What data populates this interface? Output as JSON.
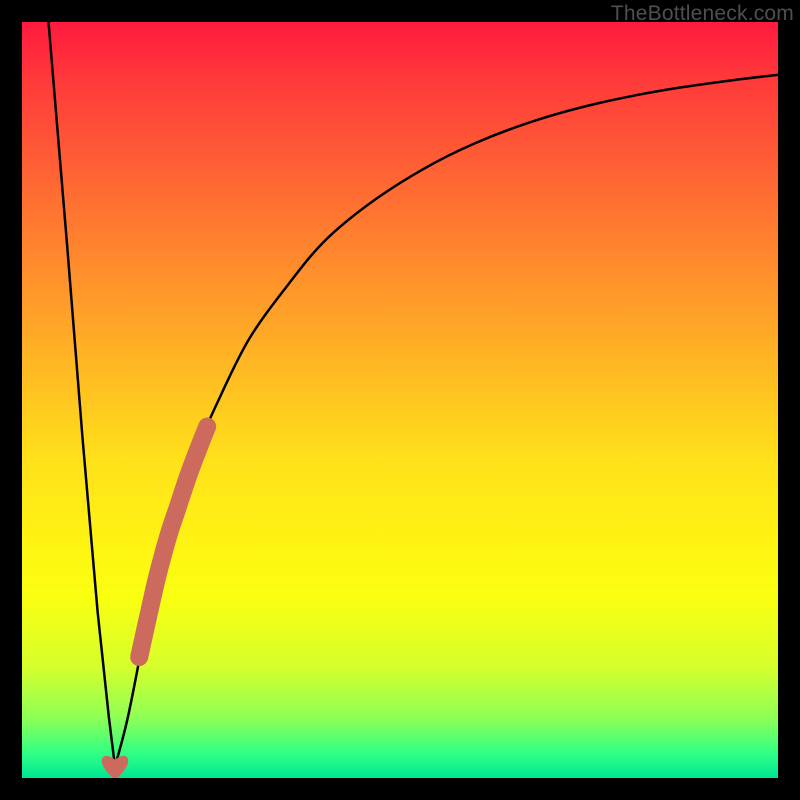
{
  "watermark": "TheBottleneck.com",
  "colors": {
    "frame": "#000000",
    "curve": "#000000",
    "highlight": "#cc6b5d",
    "heart": "#cc6b5d"
  },
  "chart_data": {
    "type": "line",
    "title": "",
    "xlabel": "",
    "ylabel": "",
    "xlim": [
      0,
      100
    ],
    "ylim": [
      0,
      100
    ],
    "description": "V-shaped bottleneck curve over a vertical red-to-green gradient. The curve descends steeply from the top-left, reaches a minimum near x≈12, then rises with diminishing slope toward the top-right.",
    "curve": {
      "left_branch": {
        "x": [
          3.5,
          6,
          8,
          10,
          11.5,
          12.3
        ],
        "y": [
          100,
          70,
          45,
          22,
          8,
          1.5
        ]
      },
      "right_branch": {
        "x": [
          12.3,
          14,
          16,
          18,
          20,
          23,
          26,
          30,
          35,
          40,
          46,
          53,
          60,
          68,
          76,
          85,
          94,
          100
        ],
        "y": [
          1.5,
          8,
          18,
          27,
          34,
          43,
          50,
          58,
          65,
          71,
          76,
          80.5,
          84,
          87,
          89.2,
          91,
          92.3,
          93
        ]
      }
    },
    "highlight_segment": {
      "x": [
        15.5,
        16.5,
        17.5,
        18.5,
        19.5,
        20.5,
        22,
        23.5,
        24.5
      ],
      "y": [
        16,
        20.5,
        25,
        29,
        32.5,
        35.5,
        40,
        44,
        46.5
      ]
    },
    "minimum_point": {
      "x": 12.3,
      "y": 1.5
    }
  }
}
